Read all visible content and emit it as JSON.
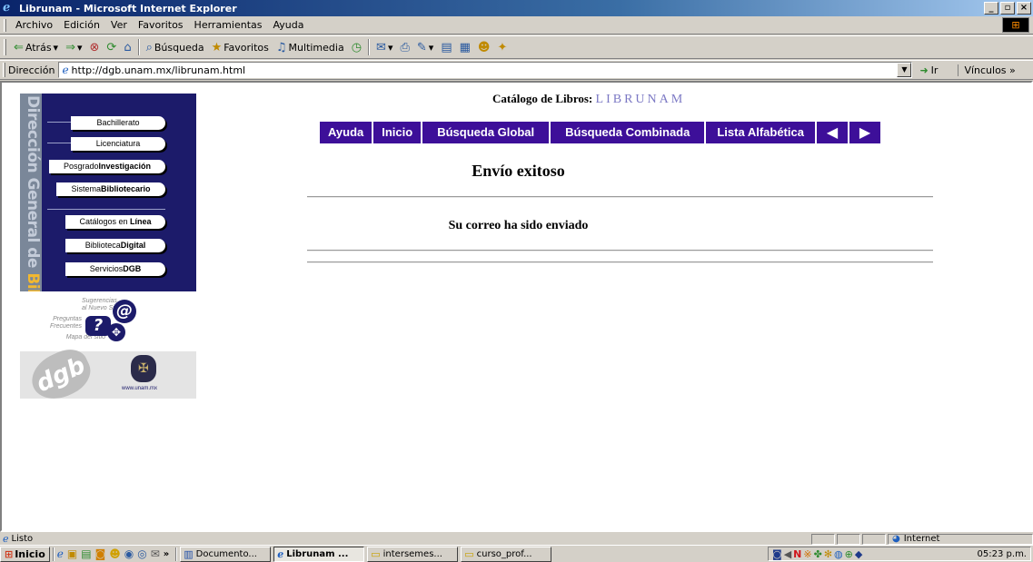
{
  "window": {
    "title": "Librunam - Microsoft Internet Explorer",
    "minimize": "_",
    "maximize": "▫",
    "close": "×"
  },
  "menu": {
    "items": [
      "Archivo",
      "Edición",
      "Ver",
      "Favoritos",
      "Herramientas",
      "Ayuda"
    ]
  },
  "toolbar": {
    "back": "Atrás",
    "search": "Búsqueda",
    "favorites": "Favoritos",
    "media": "Multimedia"
  },
  "address": {
    "label": "Dirección",
    "url": "http://dgb.unam.mx/librunam.html",
    "go": "Ir",
    "links": "Vínculos »"
  },
  "sidebar": {
    "vertical_text_pre": "Dirección General de ",
    "vertical_text_hl": "Bibliotecas",
    "buttons": [
      {
        "pre": "Bachillerato",
        "bold": ""
      },
      {
        "pre": "Licenciatura",
        "bold": ""
      },
      {
        "pre": "Posgrado",
        "bold": "Investigación"
      },
      {
        "pre": "Sistema",
        "bold": "Bibliotecario"
      },
      {
        "pre": "Catálogos en ",
        "bold": "Línea"
      },
      {
        "pre": "Biblioteca",
        "bold": "Digital"
      },
      {
        "pre": "Servicios",
        "bold": "DGB"
      }
    ],
    "help_suggestions": "Sugerencias\nal Nuevo Sitio",
    "help_faq": "Preguntas\nFrecuentes",
    "help_map": "Mapa del sitio",
    "unam_url": "www.unam.mx"
  },
  "main": {
    "catalog_label": "Catálogo de Libros:",
    "catalog_brand": "LIBRUNAM",
    "nav": {
      "help": "Ayuda",
      "home": "Inicio",
      "global_search": "Búsqueda Global",
      "combined_search": "Búsqueda Combinada",
      "alpha_list": "Lista Alfabética",
      "prev": "◀",
      "next": "▶"
    },
    "heading": "Envío exitoso",
    "message": "Su correo ha sido enviado"
  },
  "status": {
    "text": "Listo",
    "zone": "Internet"
  },
  "taskbar": {
    "start": "Inicio",
    "more": "»",
    "tasks": [
      "Documento...",
      "Librunam ...",
      "intersemes...",
      "curso_prof..."
    ],
    "clock": "05:23 p.m."
  },
  "colors": {
    "nav_purple": "#3d0f99",
    "panel_navy": "#1c1b6a",
    "brand_lavender": "#7b78c4",
    "title_bar_blue": "#0a246a"
  }
}
